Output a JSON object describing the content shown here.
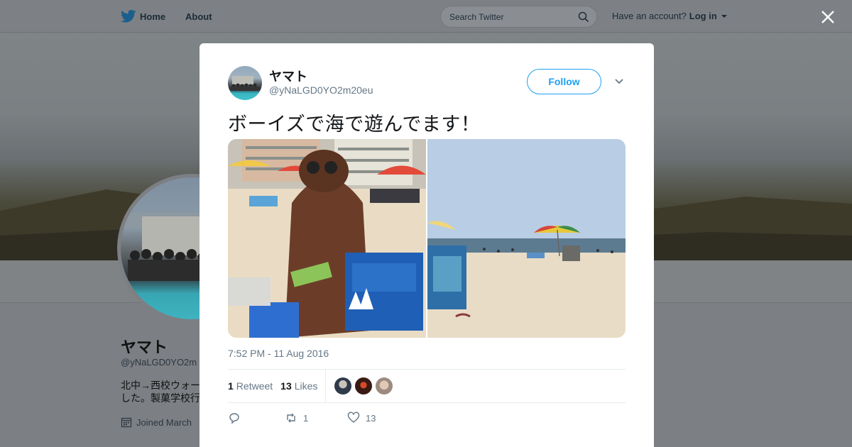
{
  "topbar": {
    "home_label": "Home",
    "about_label": "About",
    "search_placeholder": "Search Twitter",
    "have_account": "Have an account?",
    "login_label": "Log in"
  },
  "profile": {
    "name": "ヤマト",
    "handle": "@yNaLGD0YO2m",
    "bio": "北中→西校ウォー\nした。製菓学校行",
    "joined": "Joined March"
  },
  "tweet": {
    "name": "ヤマト",
    "handle": "@yNaLGD0YO2m20eu",
    "follow_label": "Follow",
    "text": "ボーイズで海で遊んでます！",
    "timestamp": "7:52 PM - 11 Aug 2016",
    "retweets_count": "1",
    "retweets_label": "Retweet",
    "likes_count": "13",
    "likes_label": "Likes",
    "reply_count": "",
    "retweet_action_count": "1",
    "like_action_count": "13"
  },
  "colors": {
    "accent": "#1da1f2",
    "overlay": "#808080"
  }
}
